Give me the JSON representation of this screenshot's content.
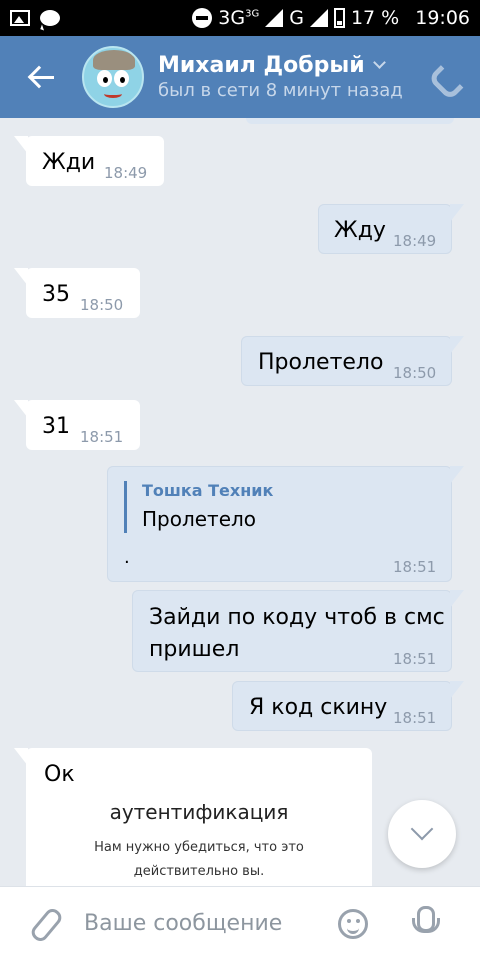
{
  "status_bar": {
    "network": "3G",
    "network_sup": "3G",
    "network2": "G",
    "battery": "17 %",
    "time": "19:06"
  },
  "header": {
    "name": "Михаил Добрый",
    "status": "был в сети 8 минут назад"
  },
  "messages": [
    {
      "dir": "in",
      "text": "Жди",
      "time": "18:49"
    },
    {
      "dir": "out",
      "text": "Жду",
      "time": "18:49"
    },
    {
      "dir": "in",
      "text": "35",
      "time": "18:50"
    },
    {
      "dir": "out",
      "text": "Пролетело",
      "time": "18:50"
    },
    {
      "dir": "in",
      "text": "31",
      "time": "18:51"
    },
    {
      "dir": "out",
      "quote_author": "Тошка Техник",
      "quote_text": "Пролетело",
      "text": ".",
      "time": "18:51"
    },
    {
      "dir": "out",
      "text_line1": "Зайди по коду чтоб в смс",
      "text_line2": "пришел",
      "time": "18:51"
    },
    {
      "dir": "out",
      "text": "Я код скину",
      "time": "18:51"
    },
    {
      "dir": "in",
      "text": "Ок",
      "card_title": "аутентификация",
      "card_line1": "Нам нужно убедиться, что это",
      "card_line2": "действительно вы."
    }
  ],
  "input": {
    "placeholder": "Ваше сообщение"
  }
}
